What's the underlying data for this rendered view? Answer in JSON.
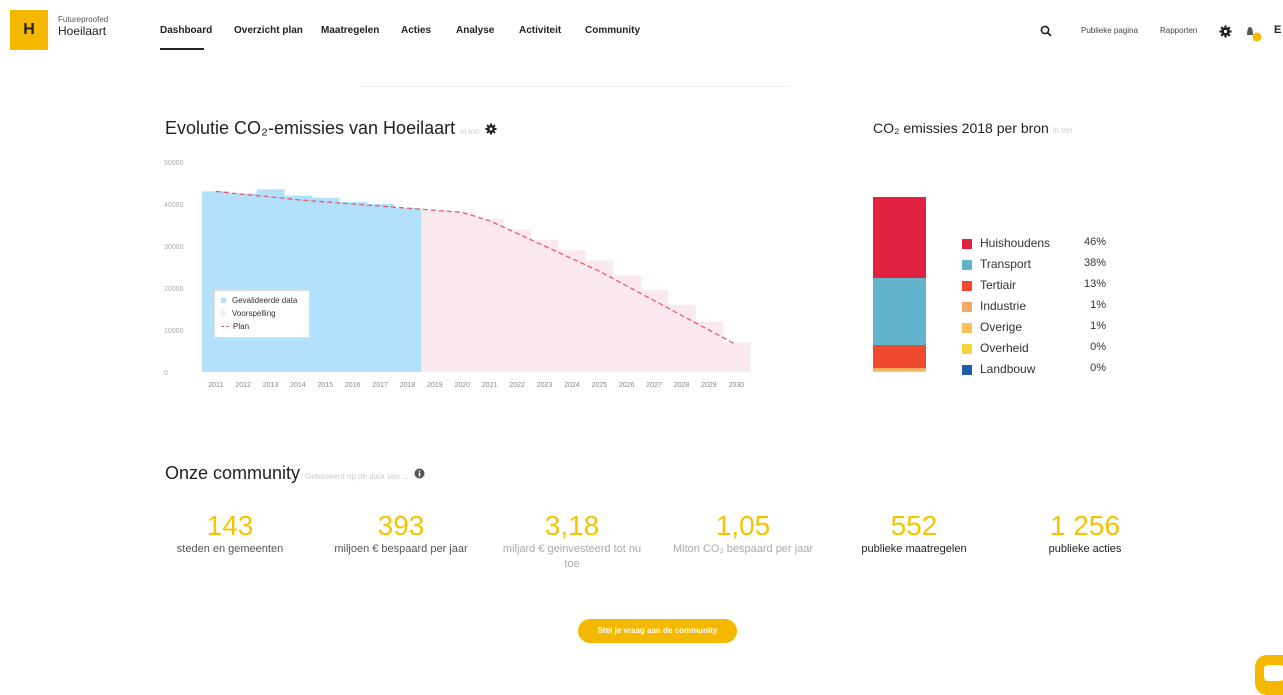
{
  "header": {
    "logo_letter": "H",
    "logo_subtitle": "Futureproofed",
    "logo_title": "Hoeilaart",
    "nav": [
      {
        "label": "Dashboard",
        "active": true
      },
      {
        "label": "Overzicht plan"
      },
      {
        "label": "Maatregelen"
      },
      {
        "label": "Acties"
      },
      {
        "label": "Analyse"
      },
      {
        "label": "Activiteit"
      },
      {
        "label": "Community"
      }
    ],
    "right_links": [
      "Publieke pagina",
      "Rapporten"
    ],
    "user_initial": "E",
    "icons": [
      "search-icon",
      "gear-icon",
      "notification-icon"
    ]
  },
  "emissions_chart": {
    "title": "Evolutie CO₂-emissies van Hoeilaart",
    "title_note": "in ton",
    "legend": [
      "Gevalideerde data",
      "Voorspelling",
      "Plan"
    ],
    "chart_data": {
      "type": "area",
      "x": [
        "2011",
        "2012",
        "2013",
        "2014",
        "2015",
        "2016",
        "2017",
        "2018",
        "2019",
        "2020",
        "2021",
        "2022",
        "2023",
        "2024",
        "2025",
        "2026",
        "2027",
        "2028",
        "2029",
        "2030"
      ],
      "ylim": [
        0,
        50000
      ],
      "yticks": [
        "0",
        "10000",
        "20000",
        "30000",
        "40000",
        "50000"
      ],
      "series": [
        {
          "name": "Gevalideerde data",
          "values": [
            43000,
            42500,
            43500,
            42000,
            41500,
            40500,
            40000,
            39000,
            null,
            null,
            null,
            null,
            null,
            null,
            null,
            null,
            null,
            null,
            null,
            null
          ],
          "color": "#b3e0fb"
        },
        {
          "name": "Voorspelling",
          "values": [
            null,
            null,
            null,
            null,
            null,
            null,
            null,
            39000,
            38500,
            38000,
            36500,
            34000,
            31500,
            29000,
            26500,
            23000,
            19500,
            16000,
            12000,
            7000
          ],
          "color": "#fbe9ef"
        },
        {
          "name": "Plan",
          "values": [
            43000,
            42300,
            41700,
            41000,
            40500,
            40000,
            39500,
            39000,
            38500,
            38000,
            36000,
            33000,
            30000,
            27000,
            24000,
            20500,
            17000,
            13500,
            10000,
            6500
          ],
          "color": "#e05f73"
        }
      ]
    }
  },
  "source_chart": {
    "title": "CO₂ emissies 2018 per bron",
    "title_note": "in ton",
    "chart_data": {
      "type": "bar",
      "categories": [
        "Huishoudens",
        "Transport",
        "Tertiair",
        "Industrie",
        "Overige",
        "Overheid",
        "Landbouw"
      ],
      "values": [
        46,
        38,
        13,
        1,
        1,
        0,
        0
      ],
      "labels": [
        "46%",
        "38%",
        "13%",
        "1%",
        "1%",
        "0%",
        "0%"
      ],
      "colors": [
        "#e0213f",
        "#62b3cb",
        "#ef4a2f",
        "#f5a868",
        "#f8c15c",
        "#f7d23a",
        "#1c5ea8"
      ]
    }
  },
  "community": {
    "title": "Onze community",
    "subtitle": "Gebaseerd op de data van ...",
    "stats": [
      {
        "value": "143",
        "label": "steden en gemeenten",
        "style": "normal"
      },
      {
        "value": "393",
        "label": "miljoen € bespaard per jaar",
        "style": "normal"
      },
      {
        "value": "3,18",
        "label": "miljard € geinvesteerd tot nu toe",
        "style": "light"
      },
      {
        "value": "1,05",
        "label": "Miton CO₂ bespaard per jaar",
        "style": "light"
      },
      {
        "value": "552",
        "label": "publieke maatregelen",
        "style": "dark"
      },
      {
        "value": "1 256",
        "label": "publieke acties",
        "style": "dark"
      }
    ],
    "cta_label": "Stel je vraag aan de community"
  }
}
